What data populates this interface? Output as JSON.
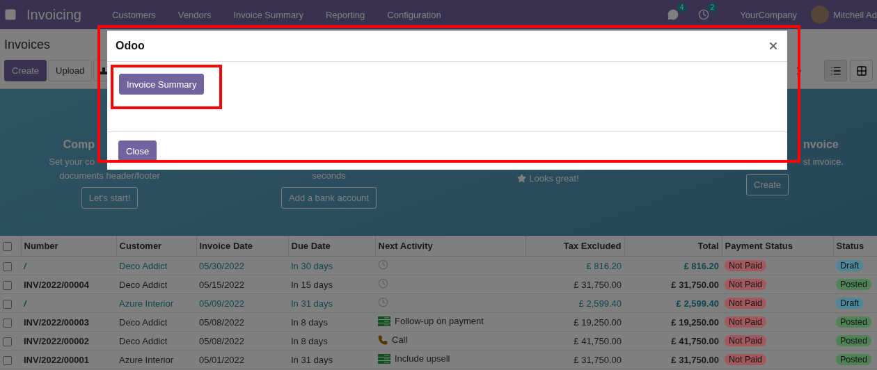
{
  "navbar": {
    "app_name": "Invoicing",
    "menu": [
      "Customers",
      "Vendors",
      "Invoice Summary",
      "Reporting",
      "Configuration"
    ],
    "messages_count": "4",
    "activities_count": "2",
    "company": "YourCompany",
    "user": "Mitchell Ad"
  },
  "control_panel": {
    "title": "Invoices",
    "buttons": [
      {
        "label": "Create",
        "kind": "primary"
      },
      {
        "label": "Upload",
        "kind": "secondary"
      }
    ]
  },
  "onboarding": {
    "steps": [
      {
        "title": "Comp",
        "lines": [
          "Set your co",
          "documents header/footer"
        ],
        "action": "Let's start!",
        "done": false
      },
      {
        "lines": [
          "seconds"
        ],
        "action": "Add a bank account",
        "done": false
      },
      {
        "done": true,
        "done_label": "Looks great!"
      },
      {
        "title": "nvoice",
        "lines": [
          "st invoice."
        ],
        "action": "Create",
        "done": false
      }
    ]
  },
  "table": {
    "select_all_checked": false,
    "columns": [
      "Number",
      "Customer",
      "Invoice Date",
      "Due Date",
      "Next Activity",
      "Tax Excluded",
      "Total",
      "Payment Status",
      "Status"
    ],
    "rows": [
      {
        "checked": false,
        "draft": true,
        "number": "/",
        "customer": "Deco Addict",
        "invoice_date": "05/30/2022",
        "due_date": "In 30 days",
        "activity": {
          "kind": "none"
        },
        "tax_excluded": "£ 816.20",
        "total": "£ 816.20",
        "payment_status": {
          "label": "Not Paid",
          "color": "#a3585d"
        },
        "status": {
          "label": "Draft",
          "color": "#4c8799"
        }
      },
      {
        "checked": false,
        "draft": false,
        "number": "INV/2022/00004",
        "customer": "Deco Addict",
        "invoice_date": "05/15/2022",
        "due_date": "In 15 days",
        "activity": {
          "kind": "none"
        },
        "tax_excluded": "£ 31,750.00",
        "total": "£ 31,750.00",
        "payment_status": {
          "label": "Not Paid",
          "color": "#a3585d"
        },
        "status": {
          "label": "Posted",
          "color": "#4f8255"
        }
      },
      {
        "checked": false,
        "draft": true,
        "number": "/",
        "customer": "Azure Interior",
        "invoice_date": "05/09/2022",
        "due_date": "In 31 days",
        "activity": {
          "kind": "none"
        },
        "tax_excluded": "£ 2,599.40",
        "total": "£ 2,599.40",
        "payment_status": {
          "label": "Not Paid",
          "color": "#a3585d"
        },
        "status": {
          "label": "Draft",
          "color": "#4c8799"
        }
      },
      {
        "checked": false,
        "draft": false,
        "number": "INV/2022/00003",
        "customer": "Deco Addict",
        "invoice_date": "05/08/2022",
        "due_date": "In 8 days",
        "activity": {
          "kind": "todo",
          "label": "Follow-up on payment"
        },
        "tax_excluded": "£ 19,250.00",
        "total": "£ 19,250.00",
        "payment_status": {
          "label": "Not Paid",
          "color": "#a3585d"
        },
        "status": {
          "label": "Posted",
          "color": "#4f8255"
        }
      },
      {
        "checked": false,
        "draft": false,
        "number": "INV/2022/00002",
        "customer": "Deco Addict",
        "invoice_date": "05/08/2022",
        "due_date": "In 8 days",
        "activity": {
          "kind": "call",
          "label": "Call"
        },
        "tax_excluded": "£ 41,750.00",
        "total": "£ 41,750.00",
        "payment_status": {
          "label": "Not Paid",
          "color": "#a3585d"
        },
        "status": {
          "label": "Posted",
          "color": "#4f8255"
        }
      },
      {
        "checked": false,
        "draft": false,
        "number": "INV/2022/00001",
        "customer": "Azure Interior",
        "invoice_date": "05/01/2022",
        "due_date": "In 31 days",
        "activity": {
          "kind": "todo",
          "label": "Include upsell"
        },
        "tax_excluded": "£ 31,750.00",
        "total": "£ 31,750.00",
        "payment_status": {
          "label": "Not Paid",
          "color": "#a3585d"
        },
        "status": {
          "label": "Posted",
          "color": "#4f8255"
        }
      }
    ]
  },
  "dialog": {
    "title": "Odoo",
    "body_button": "Invoice Summary",
    "footer_button": "Close"
  }
}
